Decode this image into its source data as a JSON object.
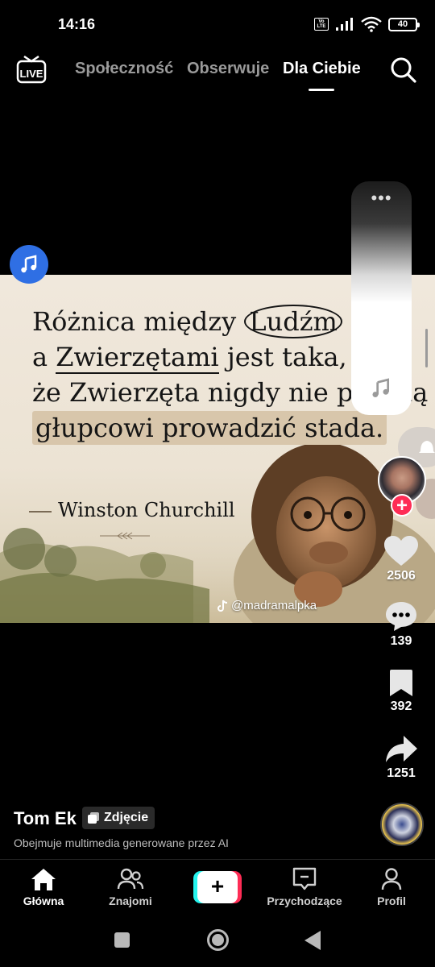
{
  "status_bar": {
    "time": "14:16",
    "volte": "Vo LTE",
    "battery": "40"
  },
  "top_nav": {
    "live_label": "LIVE",
    "tabs": [
      {
        "label": "Społeczność",
        "active": false
      },
      {
        "label": "Obserwuje",
        "active": false
      },
      {
        "label": "Dla Ciebie",
        "active": true
      }
    ]
  },
  "post": {
    "quote_lines": [
      [
        "Różnica między ",
        "Ludźm"
      ],
      [
        "a ",
        "Zwierzętami",
        " jest taka,"
      ],
      [
        "że Zwierzęta nigdy nie pozw",
        "lą"
      ],
      [
        "głupcowi prowadzić stada."
      ]
    ],
    "author": "Winston Churchill",
    "watermark": "@madramalpka"
  },
  "actions": {
    "likes": "2506",
    "comments": "139",
    "saves": "392",
    "shares": "1251"
  },
  "author_info": {
    "username": "Tom Ek",
    "badge": "Zdjęcie",
    "ai_note": "Obejmuje multimedia generowane przez AI"
  },
  "bottom_nav": {
    "items": [
      {
        "label": "Główna",
        "active": true
      },
      {
        "label": "Znajomi",
        "active": false
      },
      {
        "label": "Przychodzące",
        "active": false
      },
      {
        "label": "Profil",
        "active": false
      }
    ]
  },
  "colors": {
    "accent_red": "#fe2c55",
    "accent_cyan": "#25f4ee",
    "music_blue": "#2f6fe4"
  }
}
